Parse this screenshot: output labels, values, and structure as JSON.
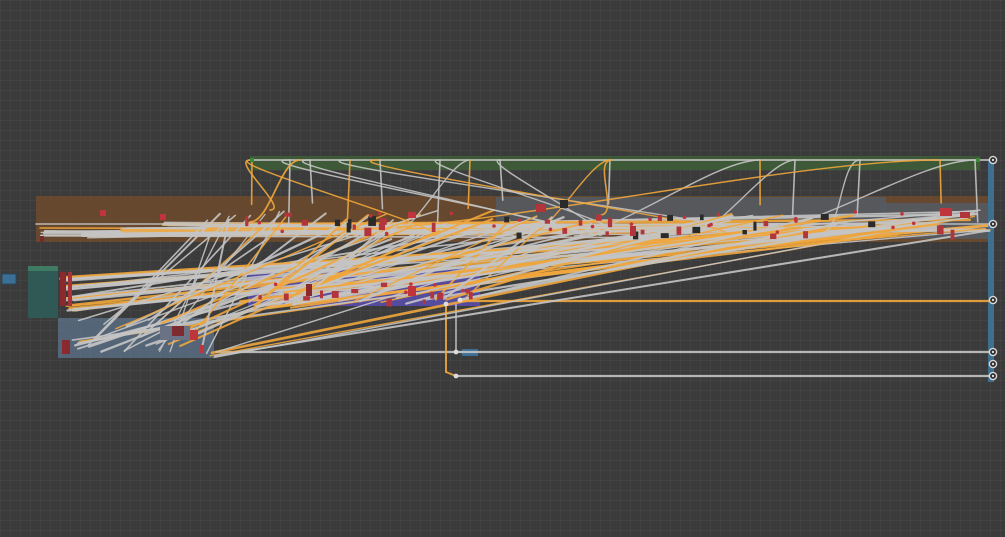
{
  "app": {
    "view": "node-editor",
    "visible_text": []
  },
  "colors": {
    "background": "#3b3b3b",
    "grid_line": "#454545",
    "frame_green": "#3e5b38",
    "frame_brown": "#6a4a2c",
    "frame_brown_dark": "#523b26",
    "frame_gray": "#555a62",
    "frame_purple": "#5a4fb0",
    "frame_blue_gray": "#5b6d84",
    "frame_teal": "#2f5a55",
    "output_column": "#3f6f8f",
    "wire_gray": "#c4c4c4",
    "wire_orange": "#f0a63c",
    "socket_red": "#c0353b",
    "output_socket": "#d9d9d9",
    "input_node": "#3b6f96"
  },
  "counts": {
    "frames": 8,
    "output_sockets": 6
  }
}
